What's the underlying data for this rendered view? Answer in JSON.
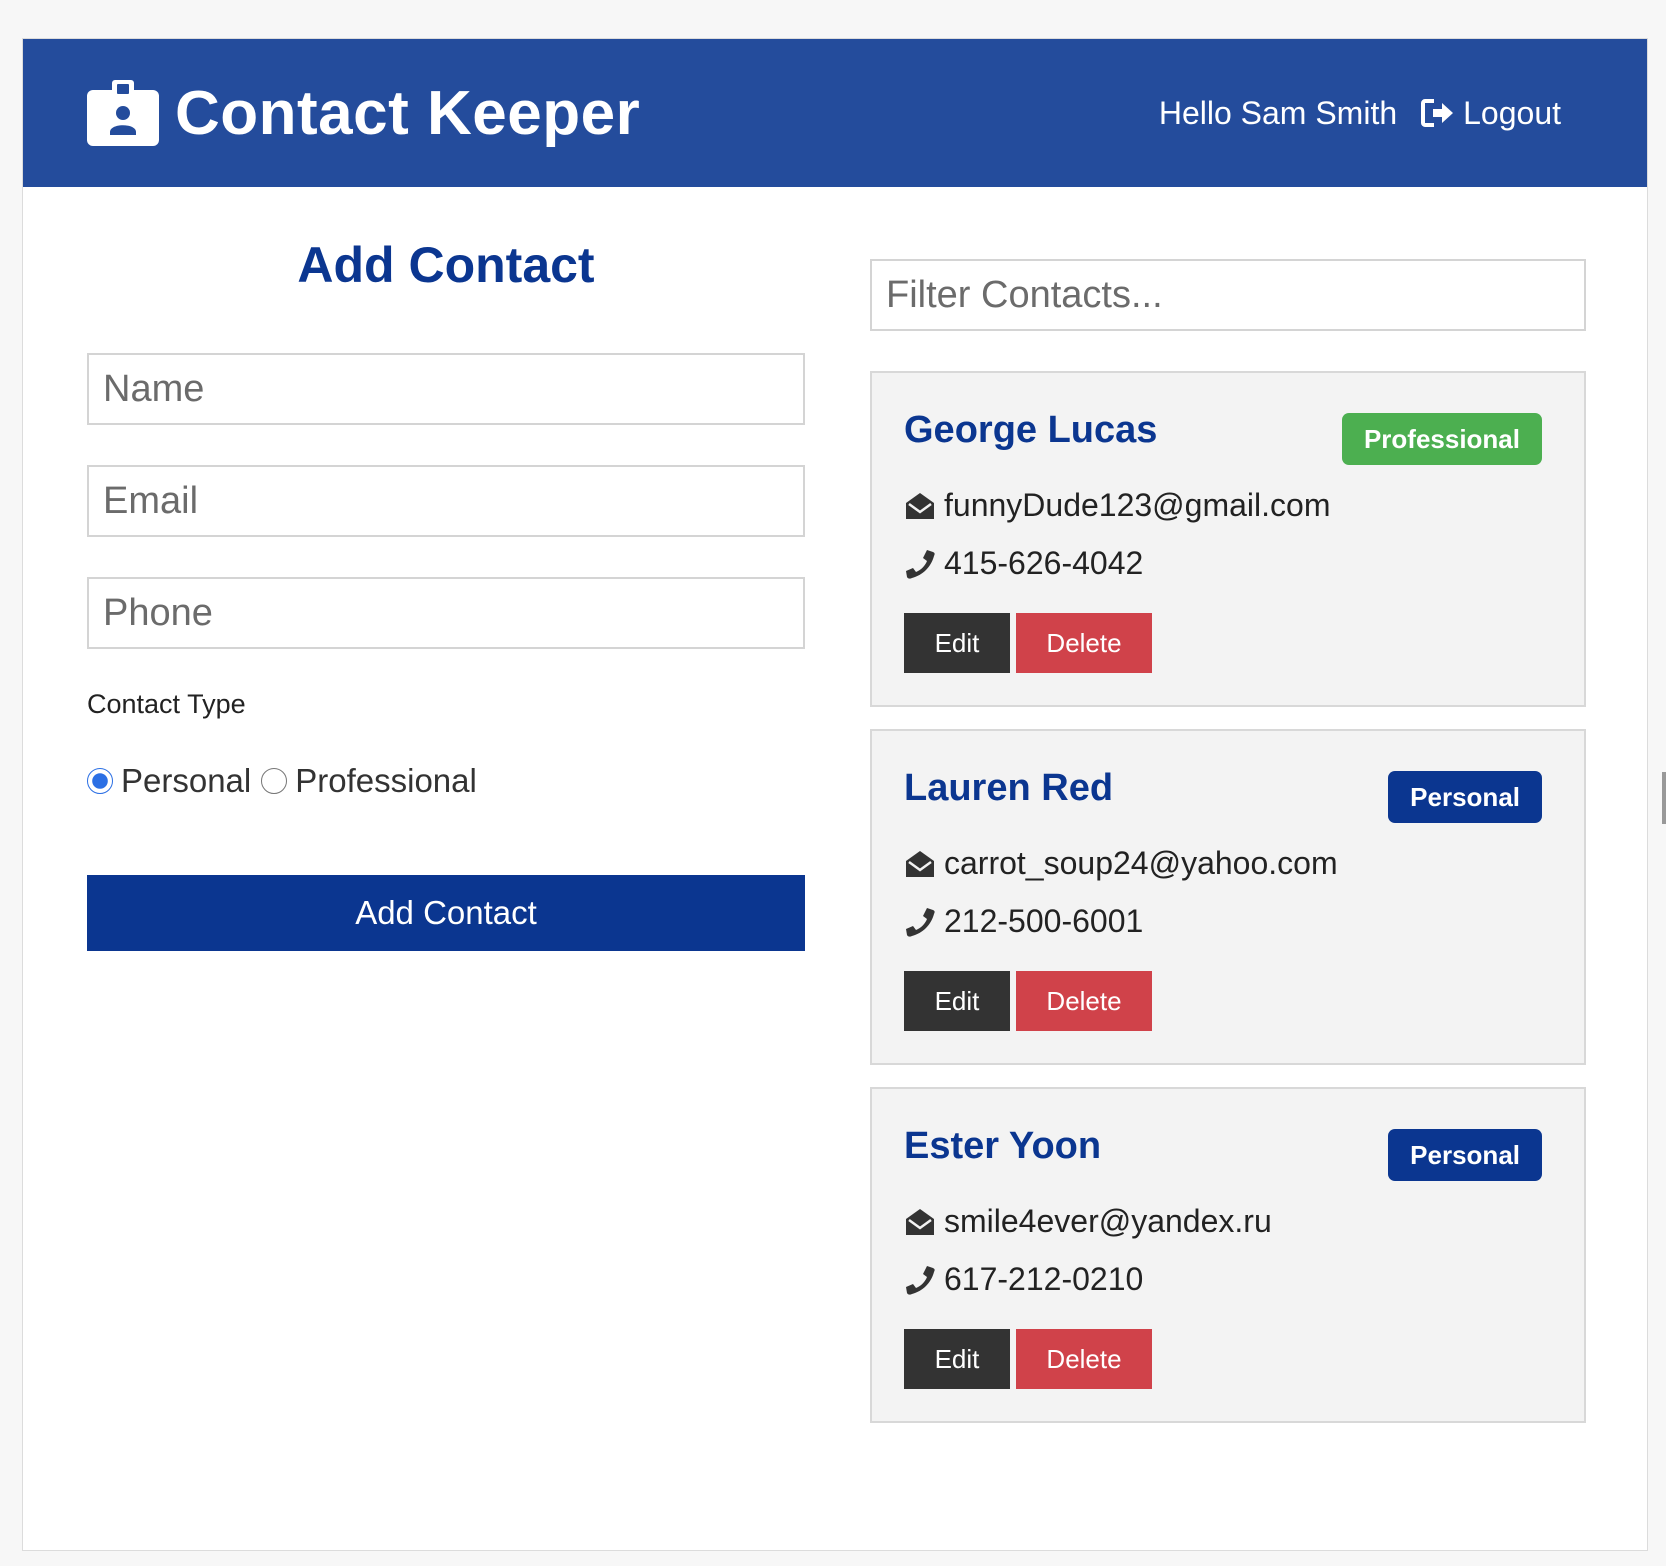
{
  "navbar": {
    "title": "Contact Keeper",
    "brand_icon": "id-badge-icon",
    "greeting": "Hello Sam Smith",
    "logout_label": "Logout",
    "logout_icon": "sign-out-icon",
    "background_color": "#244c9c"
  },
  "form": {
    "title": "Add Contact",
    "name_placeholder": "Name",
    "email_placeholder": "Email",
    "phone_placeholder": "Phone",
    "type_label": "Contact Type",
    "radio_personal_label": "Personal",
    "radio_professional_label": "Professional",
    "selected_type": "Personal",
    "submit_label": "Add Contact"
  },
  "filter": {
    "placeholder": "Filter Contacts..."
  },
  "contacts": [
    {
      "name": "George Lucas",
      "type": "Professional",
      "email": "funnyDude123@gmail.com",
      "phone": "415-626-4042",
      "edit_label": "Edit",
      "delete_label": "Delete"
    },
    {
      "name": "Lauren Red",
      "type": "Personal",
      "email": "carrot_soup24@yahoo.com",
      "phone": "212-500-6001",
      "edit_label": "Edit",
      "delete_label": "Delete"
    },
    {
      "name": "Ester Yoon",
      "type": "Personal",
      "email": "smile4ever@yandex.ru",
      "phone": "617-212-0210",
      "edit_label": "Edit",
      "delete_label": "Delete"
    }
  ],
  "colors": {
    "primary": "#0b3690",
    "success": "#4caf50",
    "danger": "#d0424a",
    "dark": "#333333",
    "card_bg": "#f3f3f3"
  },
  "icons": {
    "email": "envelope-open-icon",
    "phone": "phone-icon"
  }
}
